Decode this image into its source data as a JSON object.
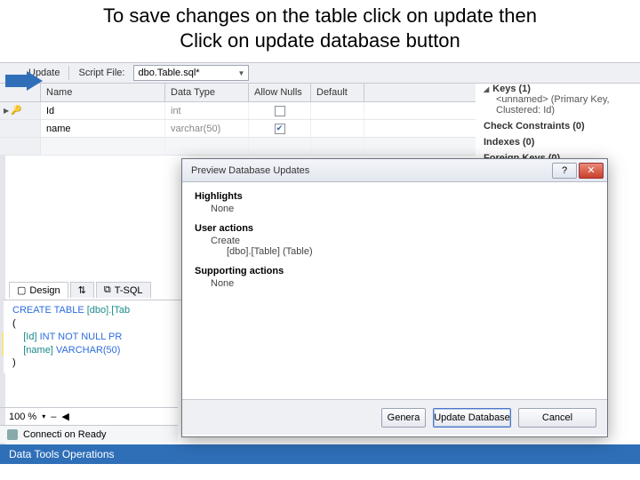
{
  "title": {
    "line1": "To save changes on the table click on update then",
    "line2": "Click on update database button"
  },
  "toolbar": {
    "update": "Update",
    "scriptfile_label": "Script File:",
    "scriptfile_value": "dbo.Table.sql*"
  },
  "grid": {
    "headers": {
      "name": "Name",
      "type": "Data Type",
      "nulls": "Allow Nulls",
      "default": "Default"
    },
    "rows": [
      {
        "name": "Id",
        "type": "int",
        "nulls": false,
        "pk": true
      },
      {
        "name": "name",
        "type": "varchar(50)",
        "nulls": true,
        "pk": false
      }
    ]
  },
  "side": {
    "keys_head": "Keys (1)",
    "keys_item": "<unnamed>  (Primary Key, Clustered: Id)",
    "checks_head": "Check Constraints (0)",
    "indexes_head": "Indexes (0)",
    "fk_head": "Foreign Keys (0)"
  },
  "tabs": {
    "design": "Design",
    "split": "⇅",
    "sql": "T-SQL"
  },
  "sql": {
    "l1a": "CREATE TABLE ",
    "l1b": "[dbo].[Tab",
    "l2": "(",
    "l3a": "[Id] ",
    "l3b": "INT NOT NULL PR",
    "l4a": "[name] ",
    "l4b": "VARCHAR(50)",
    "l5": ")"
  },
  "zoom": {
    "value": "100 %",
    "caret": "▾",
    "dash": "–"
  },
  "status": {
    "text": "Connecti on Ready"
  },
  "bottom_bar": "Data Tools Operations",
  "dialog": {
    "title": "Preview Database Updates",
    "help": "?",
    "close": "✕",
    "highlights": "Highlights",
    "none": "None",
    "user_actions": "User actions",
    "create": "Create",
    "create_item": "[dbo].[Table] (Table)",
    "supporting": "Supporting actions",
    "buttons": {
      "generate": "Genera",
      "update": "Update Database",
      "cancel": "Cancel"
    }
  }
}
